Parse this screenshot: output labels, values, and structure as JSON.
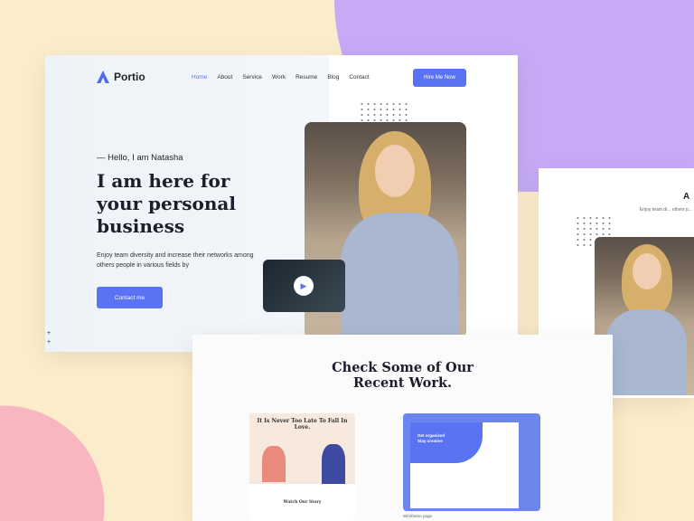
{
  "colors": {
    "accent": "#5a73f3",
    "background": "#fbeccb",
    "purple": "#c6aaf6",
    "pink": "#f7b6c0"
  },
  "header": {
    "logo": "Portio",
    "nav": [
      "Home",
      "About",
      "Service",
      "Work",
      "Resume",
      "Blog",
      "Contact"
    ],
    "active": "Home",
    "cta": "Hire Me Now"
  },
  "hero": {
    "greeting": "— Hello, I am Natasha",
    "headline": "I am here for your personal business",
    "description": "Enjoy team diversity and increase their networks among others people in various fields by",
    "button": "Contact me",
    "play_icon": "play-icon"
  },
  "side_preview": {
    "title": "A",
    "text": "Enjoy team di... others p..."
  },
  "work": {
    "title": "Check Some of Our Recent Work.",
    "projects": [
      {
        "title": "It Is Never Too Late To Fall In Love.",
        "subtitle": "Watch Our Story"
      },
      {
        "title": "Get organized Stay creative",
        "caption": "Wireframe page"
      }
    ]
  }
}
